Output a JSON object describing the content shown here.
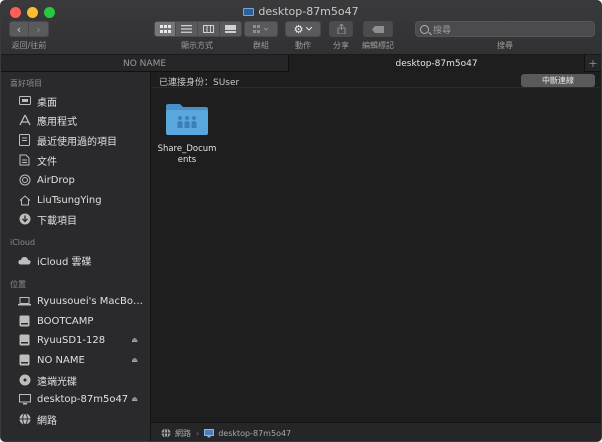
{
  "window": {
    "title": "desktop-87m5o47"
  },
  "toolbar": {
    "nav_back": "‹",
    "nav_forward": "›",
    "nav_label": "返回/往前",
    "view_label": "顯示方式",
    "group_label": "群組",
    "action_label": "動作",
    "share_label": "分享",
    "tags_label": "編輯標記",
    "search_placeholder": "搜尋",
    "search_label": "搜尋"
  },
  "tabs": [
    {
      "label": "NO NAME"
    },
    {
      "label": "desktop-87m5o47"
    },
    {
      "label": "+"
    }
  ],
  "sidebar": {
    "favorites_header": "喜好項目",
    "favorites": [
      {
        "label": "桌面",
        "icon": "desktop-icon"
      },
      {
        "label": "應用程式",
        "icon": "applications-icon"
      },
      {
        "label": "最近使用過的項目",
        "icon": "recents-icon"
      },
      {
        "label": "文件",
        "icon": "documents-icon"
      },
      {
        "label": "AirDrop",
        "icon": "airdrop-icon"
      },
      {
        "label": "LiuTsungYing",
        "icon": "home-icon"
      },
      {
        "label": "下載項目",
        "icon": "downloads-icon"
      }
    ],
    "icloud_header": "iCloud",
    "icloud": [
      {
        "label": "iCloud 雲碟",
        "icon": "cloud-icon"
      }
    ],
    "locations_header": "位置",
    "locations": [
      {
        "label": "Ryuusouei's MacBoo...",
        "icon": "laptop-icon",
        "eject": false
      },
      {
        "label": "BOOTCAMP",
        "icon": "drive-icon",
        "eject": false
      },
      {
        "label": "RyuuSD1-128",
        "icon": "drive-icon",
        "eject": true
      },
      {
        "label": "NO NAME",
        "icon": "drive-icon",
        "eject": true
      },
      {
        "label": "遠端光碟",
        "icon": "disc-icon",
        "eject": false
      },
      {
        "label": "desktop-87m5o47",
        "icon": "monitor-icon",
        "eject": true
      },
      {
        "label": "網路",
        "icon": "network-icon",
        "eject": false
      }
    ]
  },
  "content": {
    "connected_as": "已連接身份：SUser",
    "disconnect_label": "中斷連線",
    "items": [
      {
        "name_line1": "Share_Docum",
        "name_line2": "ents",
        "icon": "shared-folder-icon"
      }
    ]
  },
  "pathbar": {
    "segments": [
      "網路",
      "desktop-87m5o47"
    ]
  },
  "colors": {
    "folder_blue": "#5aa7de",
    "close": "#fe5f57",
    "minimize": "#febc2e",
    "maximize": "#28c840"
  }
}
